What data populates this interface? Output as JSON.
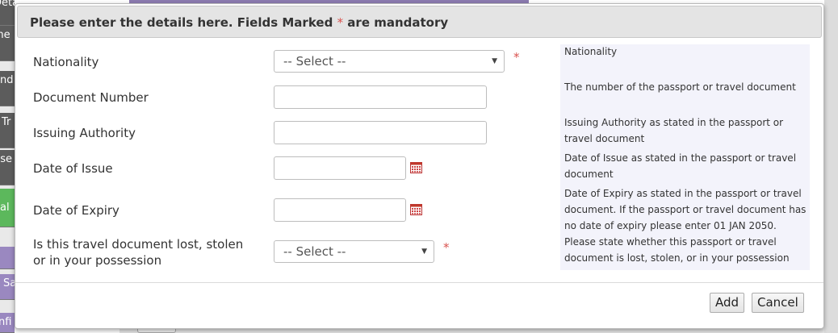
{
  "background": {
    "side_tabs": [
      {
        "label": "Details",
        "color": "#5c5c5c"
      },
      {
        "label": "me",
        "color": "#5c5c5c"
      },
      {
        "label": "and",
        "color": "#5c5c5c"
      },
      {
        "label": "Tr",
        "color": "#5c5c5c"
      },
      {
        "label": "nse",
        "color": "#5c5c5c"
      },
      {
        "label": "al",
        "color": "#5cb85c"
      },
      {
        "label": "Sa",
        "color": "#9a88c0"
      },
      {
        "label": "nfi",
        "color": "#9a88c0"
      }
    ]
  },
  "dialog": {
    "title": "Please enter the details here. Fields Marked",
    "required_marker": "*",
    "title_suffix": "are mandatory",
    "fields": {
      "nationality": {
        "label": "Nationality",
        "value": "-- Select --",
        "help": "Nationality"
      },
      "document_number": {
        "label": "Document Number",
        "value": "",
        "help": "The number of the passport or travel document"
      },
      "issuing_authority": {
        "label": "Issuing Authority",
        "value": "",
        "help": "Issuing Authority as stated in the passport or travel document"
      },
      "date_of_issue": {
        "label": "Date of Issue",
        "value": "",
        "help": "Date of Issue as stated in the passport or travel document"
      },
      "date_of_expiry": {
        "label": "Date of Expiry",
        "value": "",
        "help": "Date of Expiry as stated in the passport or travel document. If the passport or travel document has no date of expiry please enter 01 JAN 2050."
      },
      "document_status": {
        "label_line1": "Is this travel document lost, stolen",
        "label_line2": "or in your possession",
        "value": "-- Select --",
        "help": "Please state whether this passport or travel document is lost, stolen, or in your possession"
      }
    },
    "buttons": {
      "add": "Add",
      "cancel": "Cancel"
    }
  },
  "colors": {
    "required": "#d9534f",
    "header_bg": "#e4e4e4",
    "help_bg": "#f3f3fb"
  }
}
